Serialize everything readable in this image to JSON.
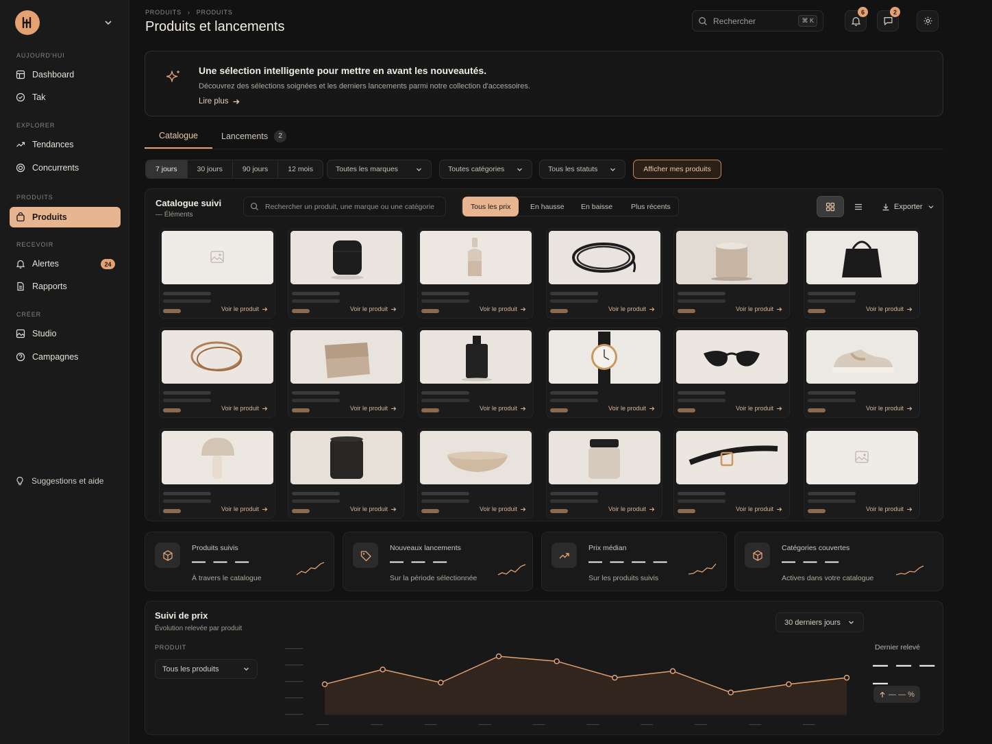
{
  "app": {
    "logo_text": "H"
  },
  "sidebar": {
    "sections": [
      {
        "label": "AUJOURD'HUI",
        "items": [
          {
            "label": "Dashboard",
            "icon": "dashboard-icon"
          },
          {
            "label": "Tak",
            "icon": "check-circle-icon"
          }
        ]
      },
      {
        "label": "EXPLORER",
        "items": [
          {
            "label": "Tendances",
            "icon": "trend-icon"
          },
          {
            "label": "Concurrents",
            "icon": "target-icon"
          }
        ]
      },
      {
        "label": "PRODUITS",
        "items": [
          {
            "label": "Produits",
            "icon": "bag-icon",
            "active": true
          }
        ]
      },
      {
        "label": "RECEVOIR",
        "items": [
          {
            "label": "Alertes",
            "icon": "bell-icon",
            "badge": "24"
          },
          {
            "label": "Rapports",
            "icon": "report-icon"
          }
        ]
      },
      {
        "label": "CRÉER",
        "items": [
          {
            "label": "Studio",
            "icon": "image-icon"
          },
          {
            "label": "Campagnes",
            "icon": "target-icon"
          }
        ]
      }
    ],
    "help_label": "Suggestions et aide"
  },
  "header": {
    "breadcrumb": [
      "PRODUITS",
      "PRODUITS"
    ],
    "title": "Produits et lancements",
    "search_placeholder": "Rechercher",
    "search_shortcut": "⌘ K",
    "notifications_count": "6",
    "messages_count": "2"
  },
  "banner": {
    "title": "Une sélection intelligente pour mettre en avant les nouveautés.",
    "text": "Découvrez des sélections soignées et les derniers lancements parmi notre collection d'accessoires.",
    "link": "Lire plus"
  },
  "tabs": [
    {
      "label": "Catalogue",
      "active": true
    },
    {
      "label": "Lancements",
      "count": "2"
    }
  ],
  "filters": {
    "periods": [
      "7 jours",
      "30 jours",
      "90 jours",
      "12 mois"
    ],
    "selected_period": "7 jours",
    "brand": "Toutes les marques",
    "category": "Toutes catégories",
    "status": "Tous les statuts",
    "my_products_button": "Afficher mes produits"
  },
  "catalogue": {
    "title": "Catalogue suivi",
    "subtitle": "— Éléments",
    "search_placeholder": "Rechercher un produit, une marque ou une catégorie",
    "price_filters": [
      "Tous les prix",
      "En hausse",
      "En baisse",
      "Plus récents"
    ],
    "selected_price_filter": "Tous les prix",
    "export_label": "Exporter",
    "card_link": "Voir le produit",
    "products": [
      "placeholder-image-icon",
      "airpods-case",
      "ceramic-vase",
      "cable-coil",
      "candle",
      "tote-bag",
      "bangle",
      "clutch-wallet",
      "perfume-bottle",
      "wristwatch",
      "sunglasses",
      "sneaker",
      "mushroom-lamp",
      "speaker-cylinder",
      "bowl",
      "jar",
      "belt",
      "placeholder-image-icon"
    ]
  },
  "stats": [
    {
      "label": "Produits suivis",
      "value": "— — —",
      "sub": "À travers le catalogue",
      "icon": "box-icon"
    },
    {
      "label": "Nouveaux lancements",
      "value": "— — —",
      "sub": "Sur la période sélectionnée",
      "icon": "tag-icon"
    },
    {
      "label": "Prix médian",
      "value": "— — — —",
      "sub": "Sur les produits suivis",
      "icon": "trend-up-icon"
    },
    {
      "label": "Catégories couvertes",
      "value": "— — —",
      "sub": "Actives dans votre catalogue",
      "icon": "box-icon"
    }
  ],
  "price_tracking": {
    "title": "Suivi de prix",
    "subtitle": "Évolution relevée par produit",
    "product_label": "PRODUIT",
    "product_select": "Tous les produits",
    "period_select": "30 derniers jours",
    "last_label": "Dernier relevé",
    "last_value": "— — — —",
    "delta_value": "— — %",
    "y_ticks": [
      "———",
      "———",
      "———",
      "———",
      "———"
    ],
    "x_ticks": [
      "——",
      "——",
      "——",
      "——",
      "——",
      "——",
      "——",
      "——",
      "——",
      "——"
    ]
  },
  "chart_data": {
    "type": "area",
    "title": "",
    "xlabel": "",
    "ylabel": "",
    "x": [
      1,
      2,
      3,
      4,
      5,
      6,
      7,
      8,
      9,
      10,
      11,
      12
    ],
    "series": [
      {
        "values": [
          1.8,
          2.7,
          1.9,
          3.5,
          3.2,
          2.2,
          2.6,
          1.3,
          1.8,
          2.2
        ]
      }
    ],
    "ylim": [
      0,
      4
    ],
    "grid": false
  },
  "colors": {
    "accent": "#e4a272",
    "background": "#121212",
    "panel": "#181818"
  }
}
